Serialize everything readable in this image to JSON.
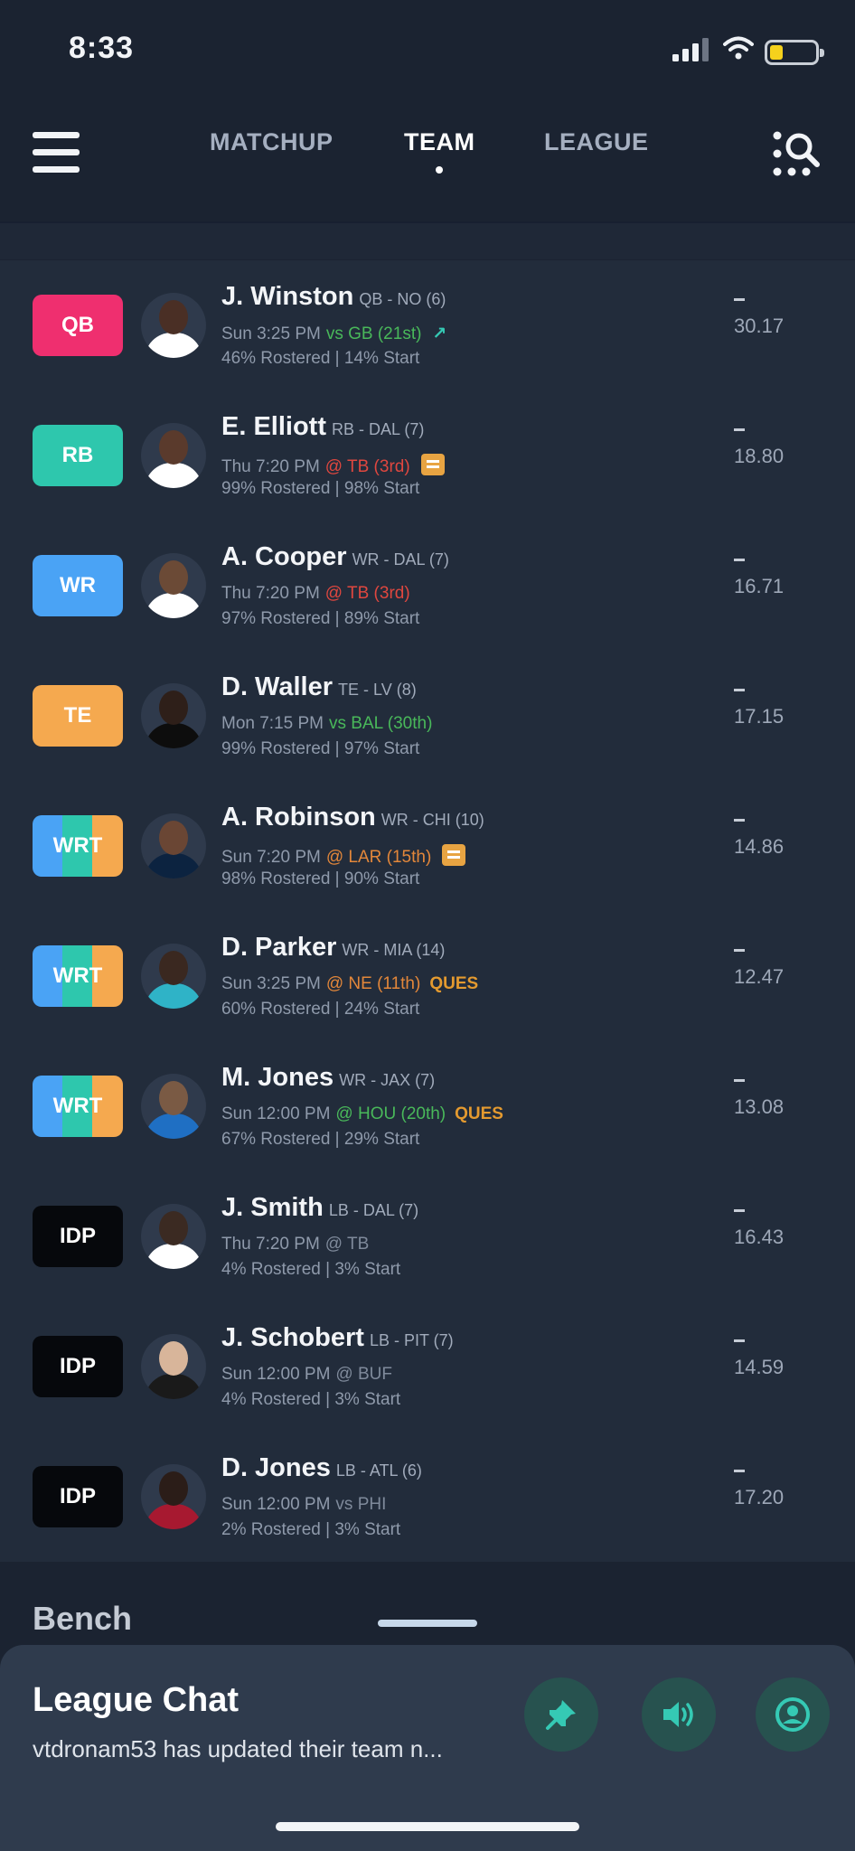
{
  "status_bar": {
    "time": "8:33"
  },
  "nav": {
    "tabs": [
      {
        "label": "MATCHUP",
        "active": false
      },
      {
        "label": "TEAM",
        "active": true
      },
      {
        "label": "LEAGUE",
        "active": false
      }
    ]
  },
  "colors": {
    "qb": "#ef2f6f",
    "rb": "#2ec7ad",
    "wr": "#4aa3f5",
    "te": "#f5a94f",
    "idp": "#06080c",
    "accent_teal": "#2ec7ad",
    "background": "#1b2331"
  },
  "roster": [
    {
      "pos": "QB",
      "pos_style": "qb",
      "name": "J. Winston",
      "meta": "QB - NO (6)",
      "game": "Sun 3:25 PM",
      "opp": "vs GB (21st)",
      "opp_color": "green",
      "extra": "trend-icon",
      "rostered": "46% Rostered | 14% Start",
      "proj": "30.17"
    },
    {
      "pos": "RB",
      "pos_style": "rb",
      "name": "E. Elliott",
      "meta": "RB - DAL (7)",
      "game": "Thu 7:20 PM",
      "opp": "@ TB (3rd)",
      "opp_color": "red",
      "extra": "news-icon",
      "rostered": "99% Rostered | 98% Start",
      "proj": "18.80"
    },
    {
      "pos": "WR",
      "pos_style": "wr",
      "name": "A. Cooper",
      "meta": "WR - DAL (7)",
      "game": "Thu 7:20 PM",
      "opp": "@ TB (3rd)",
      "opp_color": "red",
      "extra": "",
      "rostered": "97% Rostered | 89% Start",
      "proj": "16.71"
    },
    {
      "pos": "TE",
      "pos_style": "te",
      "name": "D. Waller",
      "meta": "TE - LV (8)",
      "game": "Mon 7:15 PM",
      "opp": "vs BAL (30th)",
      "opp_color": "green",
      "extra": "",
      "rostered": "99% Rostered | 97% Start",
      "proj": "17.15"
    },
    {
      "pos": "WRT",
      "pos_style": "wrt",
      "name": "A. Robinson",
      "meta": "WR - CHI (10)",
      "game": "Sun 7:20 PM",
      "opp": "@ LAR (15th)",
      "opp_color": "orange",
      "extra": "news-icon",
      "rostered": "98% Rostered | 90% Start",
      "proj": "14.86"
    },
    {
      "pos": "WRT",
      "pos_style": "wrt",
      "name": "D. Parker",
      "meta": "WR - MIA (14)",
      "game": "Sun 3:25 PM",
      "opp": "@ NE (11th)",
      "opp_color": "orange",
      "extra": "ques",
      "status": "QUES",
      "rostered": "60% Rostered | 24% Start",
      "proj": "12.47"
    },
    {
      "pos": "WRT",
      "pos_style": "wrt",
      "name": "M. Jones",
      "meta": "WR - JAX (7)",
      "game": "Sun 12:00 PM",
      "opp": "@ HOU (20th)",
      "opp_color": "green",
      "extra": "ques",
      "status": "QUES",
      "rostered": "67% Rostered | 29% Start",
      "proj": "13.08"
    },
    {
      "pos": "IDP",
      "pos_style": "idp",
      "name": "J. Smith",
      "meta": "LB - DAL (7)",
      "game": "Thu 7:20 PM",
      "opp": "@ TB",
      "opp_color": "gray",
      "extra": "",
      "rostered": "4% Rostered | 3% Start",
      "proj": "16.43"
    },
    {
      "pos": "IDP",
      "pos_style": "idp",
      "name": "J. Schobert",
      "meta": "LB - PIT (7)",
      "game": "Sun 12:00 PM",
      "opp": "@ BUF",
      "opp_color": "gray",
      "extra": "",
      "rostered": "4% Rostered | 3% Start",
      "proj": "14.59"
    },
    {
      "pos": "IDP",
      "pos_style": "idp",
      "name": "D. Jones",
      "meta": "LB - ATL (6)",
      "game": "Sun 12:00 PM",
      "opp": "vs PHI",
      "opp_color": "gray",
      "extra": "",
      "rostered": "2% Rostered | 3% Start",
      "proj": "17.20"
    }
  ],
  "bench": {
    "title": "Bench"
  },
  "chat": {
    "title": "League Chat",
    "message": "vtdronam53 has updated their team n..."
  }
}
